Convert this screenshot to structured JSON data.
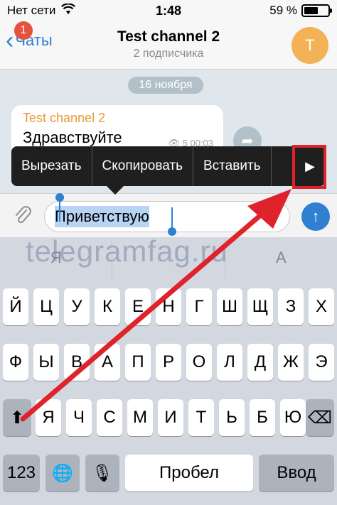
{
  "status_bar": {
    "carrier": "Нет сети",
    "time": "1:48",
    "battery_percent_label": "59 %",
    "battery_level": 0.59
  },
  "nav": {
    "back_label": "Чаты",
    "badge_count": "1",
    "title": "Test channel 2",
    "subtitle": "2 подписчика",
    "avatar_letter": "T"
  },
  "chat": {
    "date_label": "16 ноября",
    "message": {
      "sender": "Test channel 2",
      "text": "Здравствуйте",
      "meta": "👁 5 00:03"
    }
  },
  "context_menu": {
    "items": [
      "Вырезать",
      "Скопировать",
      "Вставить"
    ],
    "next_icon": "play-right-icon"
  },
  "input": {
    "value": "Приветствую"
  },
  "keyboard": {
    "predictive": [
      "Я",
      "",
      "А"
    ],
    "row1": [
      "Й",
      "Ц",
      "У",
      "К",
      "Е",
      "Н",
      "Г",
      "Ш",
      "Щ",
      "З",
      "Х"
    ],
    "row2": [
      "Ф",
      "Ы",
      "В",
      "А",
      "П",
      "Р",
      "О",
      "Л",
      "Д",
      "Ж",
      "Э"
    ],
    "row3": [
      "Я",
      "Ч",
      "С",
      "М",
      "И",
      "Т",
      "Ь",
      "Б",
      "Ю"
    ],
    "numbers_label": "123",
    "space_label": "Пробел",
    "return_label": "Ввод"
  },
  "watermark": "telegramfag.ru",
  "colors": {
    "accent": "#2f80d1",
    "badge": "#e5533f",
    "annotation": "#e0222b",
    "avatar": "#f3b256"
  }
}
